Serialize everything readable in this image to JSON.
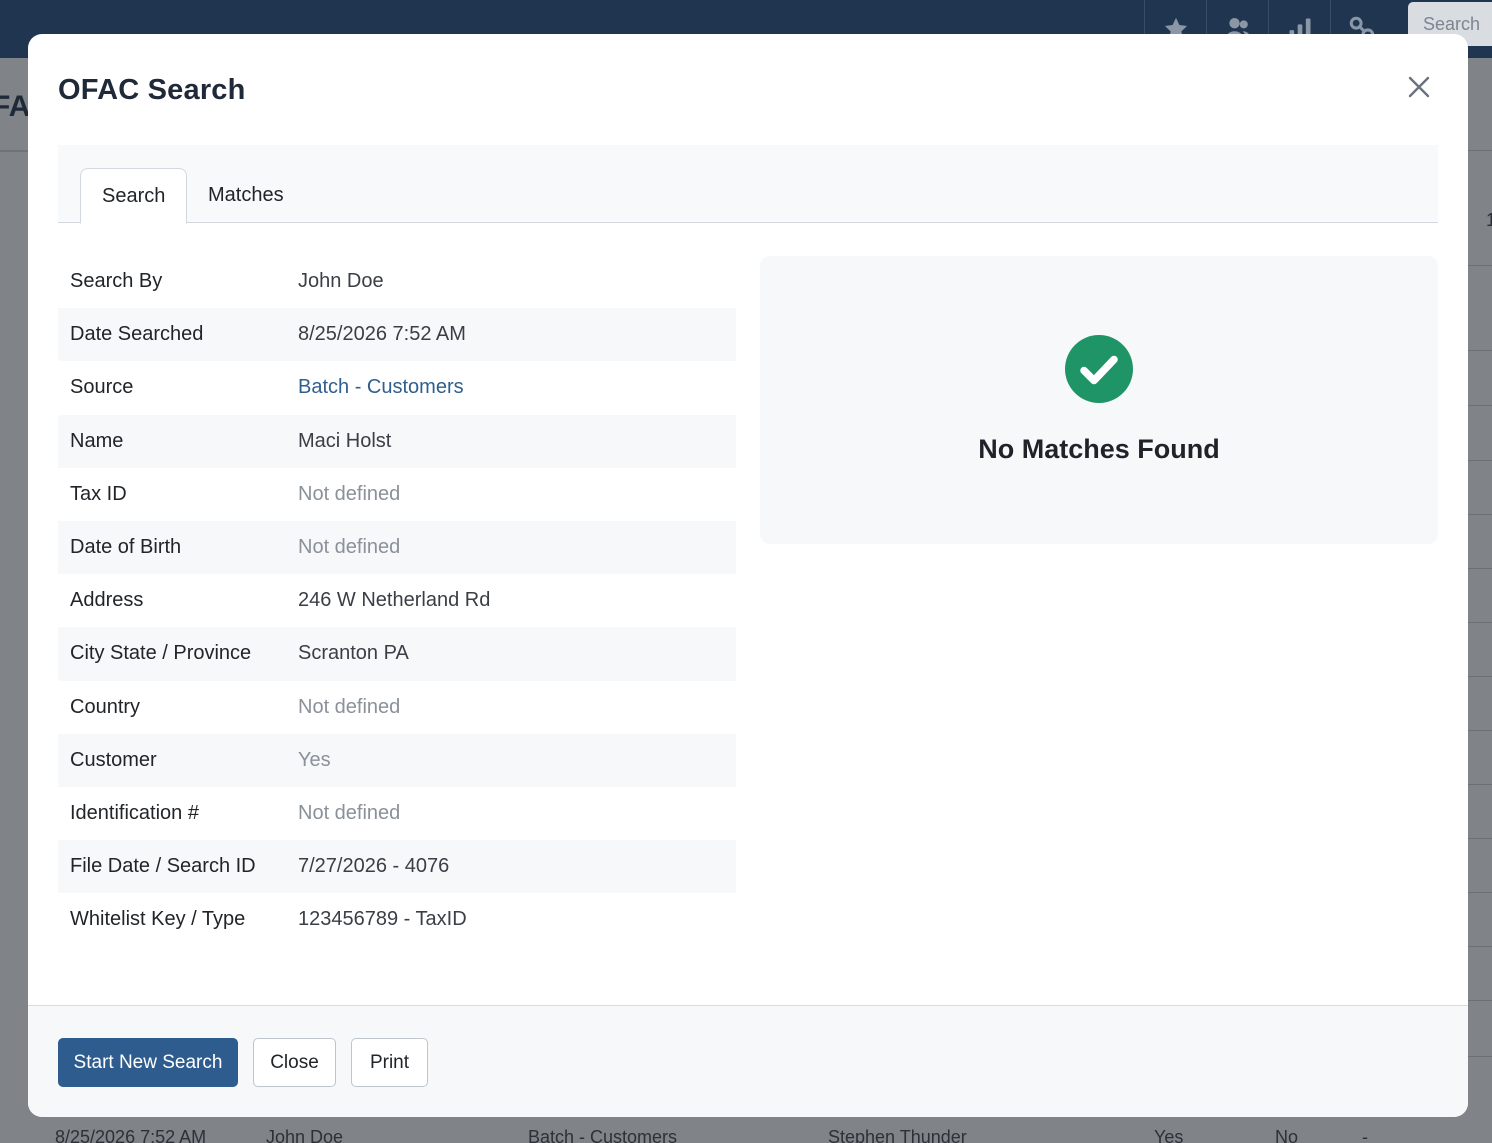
{
  "background": {
    "page_title_fragment": "FA",
    "right_number_fragment": "1",
    "topbar_search_placeholder": "Search",
    "topbar_icons": [
      "star-icon",
      "users-icon",
      "bar-chart-icon",
      "link-icon"
    ],
    "table_row": {
      "date": "8/25/2026 7:52 AM",
      "searched_by": "John Doe",
      "source": "Batch - Customers",
      "name": "Stephen Thunder",
      "customer": "Yes",
      "match": "No",
      "extra": "-"
    }
  },
  "modal": {
    "title": "OFAC Search",
    "tabs": [
      {
        "label": "Search",
        "active": true
      },
      {
        "label": "Matches",
        "active": false
      }
    ],
    "details": [
      {
        "label": "Search By",
        "value": "John Doe",
        "style": "normal"
      },
      {
        "label": "Date Searched",
        "value": "8/25/2026 7:52 AM",
        "style": "normal"
      },
      {
        "label": "Source",
        "value": "Batch - Customers",
        "style": "link"
      },
      {
        "label": "Name",
        "value": "Maci Holst",
        "style": "normal"
      },
      {
        "label": "Tax ID",
        "value": "Not defined",
        "style": "muted"
      },
      {
        "label": "Date of Birth",
        "value": "Not defined",
        "style": "muted"
      },
      {
        "label": "Address",
        "value": "246 W Netherland Rd",
        "style": "normal"
      },
      {
        "label": "City State / Province",
        "value": "Scranton PA",
        "style": "normal"
      },
      {
        "label": "Country",
        "value": "Not defined",
        "style": "muted"
      },
      {
        "label": "Customer",
        "value": "Yes",
        "style": "muted"
      },
      {
        "label": "Identification #",
        "value": "Not defined",
        "style": "muted"
      },
      {
        "label": "File Date / Search ID",
        "value": "7/27/2026 - 4076",
        "style": "normal"
      },
      {
        "label": "Whitelist Key / Type",
        "value": "123456789 - TaxID",
        "style": "normal"
      }
    ],
    "result": {
      "icon": "check-circle-icon",
      "message": "No Matches Found",
      "color": "#1f9467"
    },
    "buttons": {
      "start_new_search": "Start New Search",
      "close": "Close",
      "print": "Print"
    }
  },
  "colors": {
    "primary": "#2e5c8e",
    "link": "#2f5f8f",
    "success": "#1f9467",
    "topbar": "#203650"
  }
}
